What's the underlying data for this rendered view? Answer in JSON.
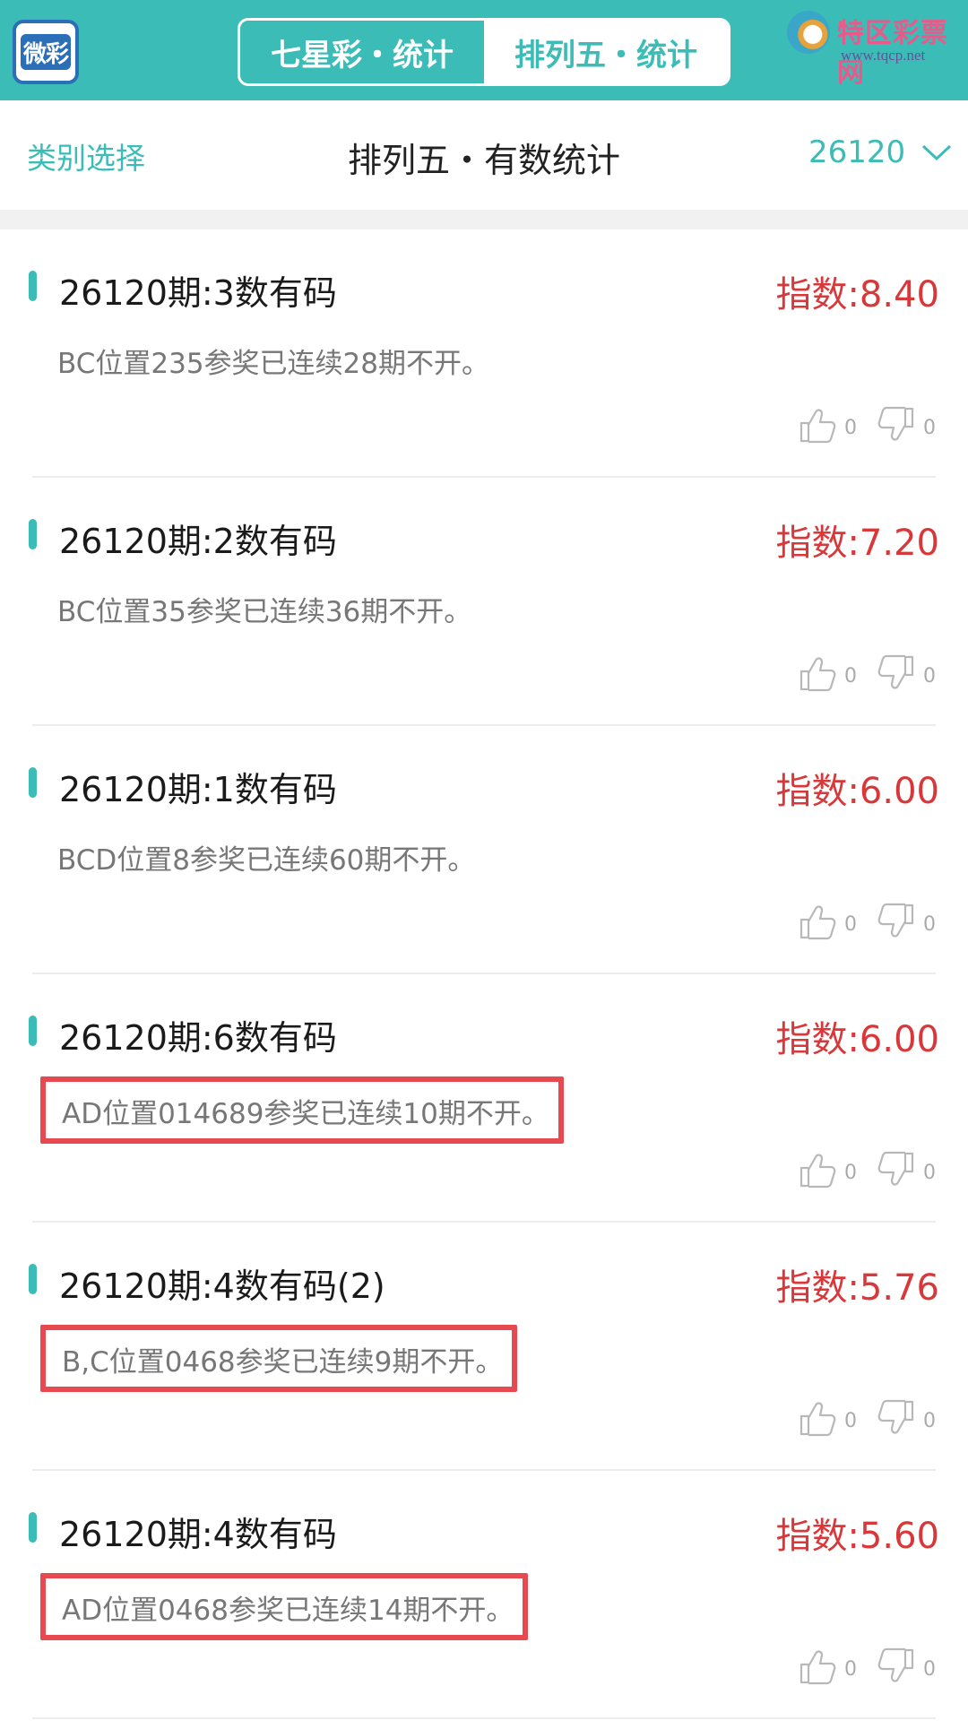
{
  "header": {
    "logo_text": "微彩",
    "tabs": [
      {
        "label": "七星彩・统计",
        "active": false
      },
      {
        "label": "排列五・统计",
        "active": true
      }
    ],
    "watermark_title": "特区彩票网",
    "watermark_url": "www.tqcp.net"
  },
  "subheader": {
    "category_label": "类别选择",
    "title": "排列五・有数统计",
    "issue": "26120"
  },
  "colors": {
    "accent": "#3cbcb6",
    "index_red": "#d9383a",
    "highlight_box": "#e8484f"
  },
  "cards": [
    {
      "title": "26120期:3数有码",
      "index": "指数:8.40",
      "desc": "BC位置235参奖已连续28期不开。",
      "up": "0",
      "down": "0"
    },
    {
      "title": "26120期:2数有码",
      "index": "指数:7.20",
      "desc": "BC位置35参奖已连续36期不开。",
      "up": "0",
      "down": "0"
    },
    {
      "title": "26120期:1数有码",
      "index": "指数:6.00",
      "desc": "BCD位置8参奖已连续60期不开。",
      "up": "0",
      "down": "0"
    },
    {
      "title": "26120期:6数有码",
      "index": "指数:6.00",
      "desc": "AD位置014689参奖已连续10期不开。",
      "up": "0",
      "down": "0"
    },
    {
      "title": "26120期:4数有码(2)",
      "index": "指数:5.76",
      "desc": "B,C位置0468参奖已连续9期不开。",
      "up": "0",
      "down": "0"
    },
    {
      "title": "26120期:4数有码",
      "index": "指数:5.60",
      "desc": "AD位置0468参奖已连续14期不开。",
      "up": "0",
      "down": "0"
    }
  ]
}
